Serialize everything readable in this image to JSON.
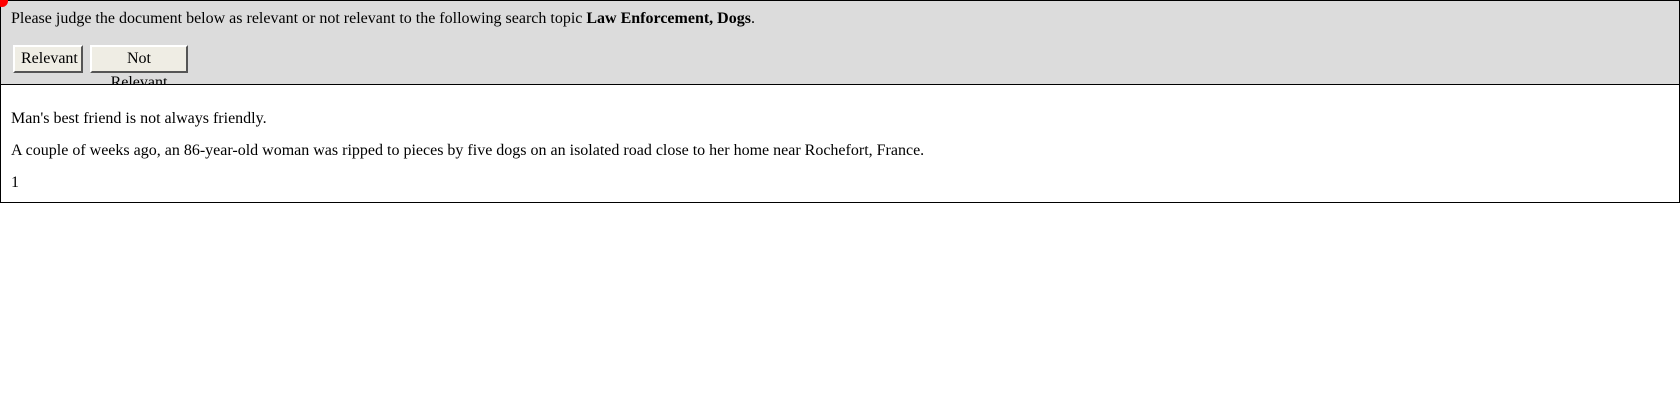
{
  "header": {
    "instruction_prefix": "Please judge the document below as relevant or not relevant to the following search topic ",
    "topic": "Law Enforcement, Dogs",
    "instruction_suffix": ".",
    "relevant_label": "Relevant",
    "not_relevant_label": "Not Relevant"
  },
  "document": {
    "lines": [
      "Man's best friend is not always friendly.",
      "A couple of weeks ago, an 86-year-old woman was ripped to pieces by five dogs on an isolated road close to her home near Rochefort, France.",
      "1"
    ]
  },
  "colors": {
    "header_background": "#dcdcdc",
    "cursor_dot": "#ff0000"
  }
}
